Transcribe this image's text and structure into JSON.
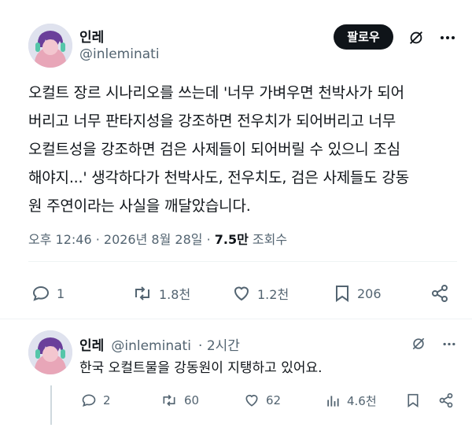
{
  "tweet": {
    "author_name": "인레",
    "author_handle": "@inleminati",
    "follow_label": "팔로우",
    "text": "오컬트 장르 시나리오를 쓰는데 '너무 가벼우면 천박사가 되어\n버리고 너무 판타지성을 강조하면 전우치가 되어버리고 너무\n오컬트성을 강조하면 검은 사제들이 되어버릴 수 있으니 조심\n해야지...' 생각하다가 천박사도, 전우치도, 검은 사제들도 강동\n원 주연이라는 사실을 깨달았습니다.",
    "timestamp": "오후 12:46 · 2026년 8월 28일 · ",
    "views_count": "7.5만",
    "views_label": "조회수",
    "stats": {
      "replies": "1",
      "retweets": "1.8천",
      "likes": "1.2천",
      "bookmarks": "206"
    }
  },
  "reply": {
    "author_name": "인레",
    "author_handle": "@inleminati",
    "time": "· 2시간",
    "text": "한국 오컬트물을 강동원이 지탱하고 있어요.",
    "stats": {
      "replies": "2",
      "retweets": "60",
      "likes": "62",
      "views": "4.6천"
    }
  },
  "icons": {
    "more": "more-horizontal-icon",
    "grok": "grok-icon",
    "reply": "reply-icon",
    "retweet": "retweet-icon",
    "like": "heart-icon",
    "bookmark": "bookmark-icon",
    "share": "share-icon",
    "views": "views-icon"
  },
  "colors": {
    "text": "#0f1419",
    "secondary": "#536471",
    "follow_bg": "#0f1419",
    "divider": "#eff3f4"
  }
}
